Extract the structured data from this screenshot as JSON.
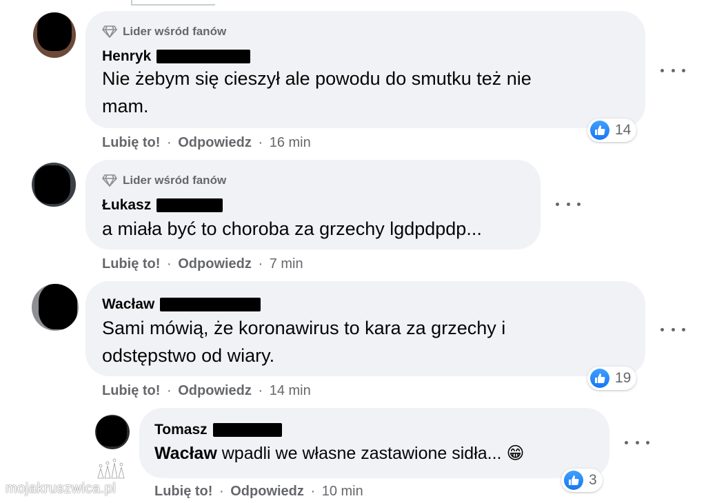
{
  "comments": [
    {
      "badge": "Lider wśród fanów",
      "author": "Henryk",
      "text_lines": [
        "Nie żebym się cieszył ale powodu do smutku też nie",
        "mam."
      ],
      "like_label": "Lubię to!",
      "reply_label": "Odpowiedz",
      "time": "16 min",
      "reaction_count": "14"
    },
    {
      "badge": "Lider wśród fanów",
      "author": "Łukasz",
      "text_lines": [
        "a miała być to choroba za grzechy lgdpdpdp..."
      ],
      "like_label": "Lubię to!",
      "reply_label": "Odpowiedz",
      "time": "7 min"
    },
    {
      "author": "Wacław",
      "text_lines": [
        "Sami mówią, że koronawirus to kara za grzechy i",
        "odstępstwo od wiary."
      ],
      "like_label": "Lubię to!",
      "reply_label": "Odpowiedz",
      "time": "14 min",
      "reaction_count": "19"
    }
  ],
  "reply": {
    "author": "Tomasz",
    "mention": "Wacław",
    "text": "wpadli we własne zastawione sidła...",
    "emoji": "😁",
    "like_label": "Lubię to!",
    "reply_label": "Odpowiedz",
    "time": "10 min",
    "reaction_count": "3"
  },
  "separator": "·",
  "watermark": "mojakruszwica.pl",
  "icons": {
    "badge": "diamond-icon",
    "reaction": "like-icon",
    "menu": "more-options-icon"
  },
  "colors": {
    "bubble": "#f0f2f5",
    "secondary_text": "#65676b",
    "like_blue": "#1877f2"
  }
}
